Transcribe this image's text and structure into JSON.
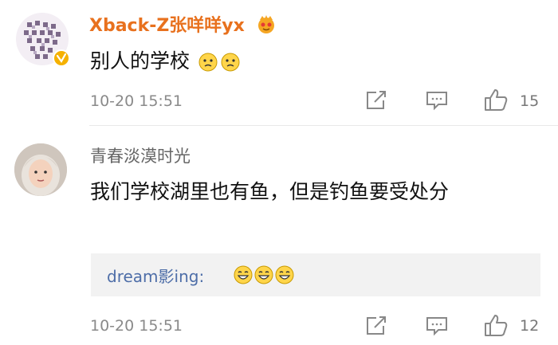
{
  "comments": [
    {
      "username": "Xback-Z张咩咩yx",
      "badge_icon": "vip-crown-icon",
      "verified_icon": "verified-badge-icon",
      "text": "别人的学校",
      "emojis": [
        "thinking-emoji",
        "thinking-emoji"
      ],
      "time": "10-20 15:51",
      "likes": "15"
    },
    {
      "username": "青春淡漠时光",
      "text": "我们学校湖里也有鱼，但是钓鱼要受处分",
      "reply": {
        "user": "dream影ing:",
        "emojis": [
          "laughing-emoji",
          "laughing-emoji",
          "laughing-emoji"
        ]
      },
      "time": "10-20 15:51",
      "likes": "12"
    }
  ],
  "colors": {
    "vip_name": "#e8711e",
    "reply_name": "#4e6ea8",
    "muted": "#8a8a8a"
  },
  "icons": {
    "share": "share-icon",
    "comment": "comment-icon",
    "like": "like-thumb-icon"
  }
}
